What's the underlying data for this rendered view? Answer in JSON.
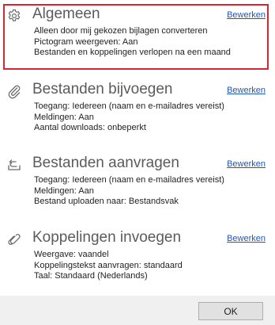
{
  "sections": [
    {
      "title": "Algemeen",
      "icon": "gear-icon",
      "edit_label": "Bewerken",
      "lines": [
        "Alleen door mij gekozen bijlagen converteren",
        "Pictogram weergeven: Aan",
        "Bestanden en koppelingen verlopen na een maand"
      ]
    },
    {
      "title": "Bestanden bijvoegen",
      "icon": "paperclip-icon",
      "edit_label": "Bewerken",
      "lines": [
        "Toegang: Iedereen (naam en e-mailadres vereist)",
        "Meldingen: Aan",
        "Aantal downloads: onbeperkt"
      ]
    },
    {
      "title": "Bestanden aanvragen",
      "icon": "upload-tray-icon",
      "edit_label": "Bewerken",
      "lines": [
        "Toegang: Iedereen (naam en e-mailadres vereist)",
        "Meldingen: Aan",
        "Bestand uploaden naar: Bestandsvak"
      ]
    },
    {
      "title": "Koppelingen invoegen",
      "icon": "link-icon",
      "edit_label": "Bewerken",
      "lines": [
        "Weergave: vaandel",
        "Koppelingstekst aanvragen: standaard",
        "Taal: Standaard (Nederlands)"
      ]
    }
  ],
  "footer": {
    "ok_label": "OK"
  },
  "colors": {
    "highlight_border": "#d9262c",
    "link": "#1f58b3",
    "footer_bg": "#f0f0f0"
  }
}
